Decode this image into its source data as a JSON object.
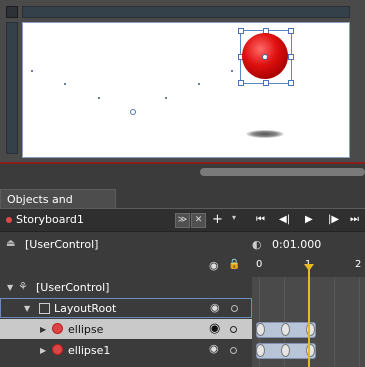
{
  "panel": {
    "title": "Objects and Timeline"
  },
  "storyboard": {
    "name": "Storyboard1",
    "add": "+",
    "caret": "▾",
    "collapse": "≫",
    "close": "✕"
  },
  "transport": {
    "first": "⏮",
    "prev": "◀|",
    "play": "▶",
    "next": "|▶",
    "last": "⏭"
  },
  "scope": {
    "label": "[UserControl]",
    "icon": "scope-up-icon"
  },
  "time": {
    "value": "0:01.000",
    "icon": "add-keyframe-icon"
  },
  "ruler": {
    "ticks": [
      "0",
      "1",
      "2"
    ]
  },
  "tree": {
    "root": {
      "label": "[UserControl]"
    },
    "layoutroot": {
      "label": "LayoutRoot"
    },
    "ellipse": {
      "label": "ellipse"
    },
    "ellipse1": {
      "label": "ellipse1"
    }
  },
  "icons": {
    "eye": "eye-icon",
    "lock": "lock-icon"
  },
  "colors": {
    "playhead": "#e8b820",
    "record": "#e04848",
    "ball": "#e01010"
  }
}
